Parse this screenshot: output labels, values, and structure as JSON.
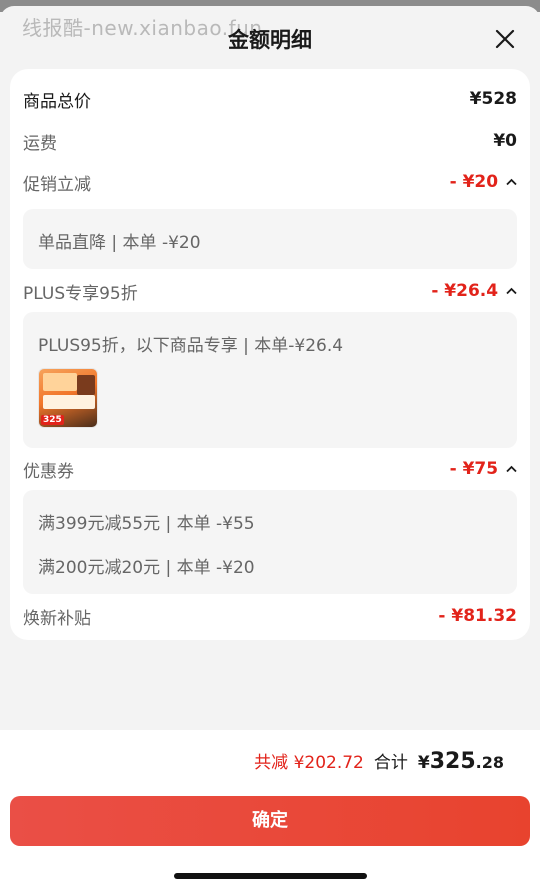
{
  "watermark": "线报酷-new.xianbao.fun",
  "title": "金额明细",
  "rows": {
    "total": {
      "label": "商品总价",
      "value": "¥528"
    },
    "shipping": {
      "label": "运费",
      "value": "¥0"
    },
    "promo": {
      "label": "促销立减",
      "value": "- ¥20",
      "detail": "单品直降 | 本单 -¥20"
    },
    "plus": {
      "label": "PLUS专享95折",
      "value": "- ¥26.4",
      "detail": "PLUS95折，以下商品专享 | 本单-¥26.4",
      "thumb_badge": "325"
    },
    "coupon": {
      "label": "优惠券",
      "value": "- ¥75",
      "details": [
        "满399元减55元 | 本单 -¥55",
        "满200元减20元 | 本单 -¥20"
      ]
    },
    "subsidy": {
      "label": "焕新补贴",
      "value": "- ¥81.32"
    }
  },
  "summary": {
    "save_text": "共减 ¥202.72",
    "total_label": "合计",
    "total_symbol": "¥",
    "total_int": "325",
    "total_dec": ".28"
  },
  "confirm_label": "确定",
  "icons": {
    "close": "close-icon",
    "chevron": "chevron-up-icon"
  },
  "colors": {
    "accent_red": "#e2231a",
    "button": "#e8432e"
  }
}
